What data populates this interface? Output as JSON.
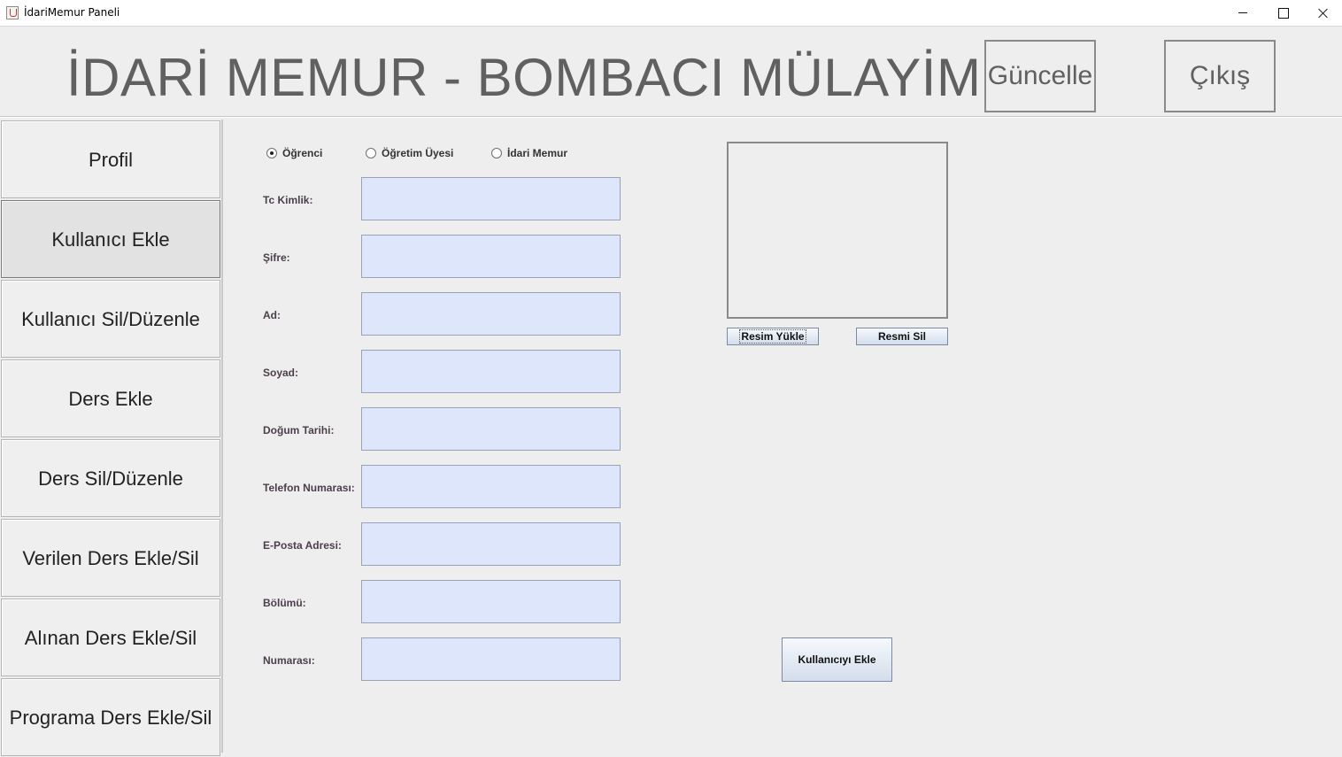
{
  "window": {
    "title": "İdariMemur Paneli"
  },
  "header": {
    "title": "İDARİ MEMUR - BOMBACI MÜLAYİM",
    "update_label": "Güncelle",
    "exit_label": "Çıkış"
  },
  "sidebar": {
    "items": [
      {
        "label": "Profil"
      },
      {
        "label": "Kullanıcı Ekle",
        "active": true
      },
      {
        "label": "Kullanıcı Sil/Düzenle"
      },
      {
        "label": "Ders Ekle"
      },
      {
        "label": "Ders Sil/Düzenle"
      },
      {
        "label": "Verilen Ders Ekle/Sil"
      },
      {
        "label": "Alınan Ders Ekle/Sil"
      },
      {
        "label": "Programa Ders Ekle/Sil"
      }
    ]
  },
  "user_type": {
    "options": [
      "Öğrenci",
      "Öğretim Üyesi",
      "İdari Memur"
    ],
    "selected": "Öğrenci"
  },
  "form": {
    "fields": [
      {
        "label": "Tc Kimlik:",
        "value": ""
      },
      {
        "label": "Şifre:",
        "value": ""
      },
      {
        "label": "Ad:",
        "value": ""
      },
      {
        "label": "Soyad:",
        "value": ""
      },
      {
        "label": "Doğum Tarihi:",
        "value": ""
      },
      {
        "label": "Telefon Numarası:",
        "value": ""
      },
      {
        "label": "E-Posta Adresi:",
        "value": ""
      },
      {
        "label": "Bölümü:",
        "value": ""
      },
      {
        "label": "Numarası:",
        "value": ""
      }
    ]
  },
  "photo": {
    "upload_label": "Resim Yükle",
    "remove_label": "Resmi Sil"
  },
  "actions": {
    "add_user_label": "Kullanıcıyı Ekle"
  },
  "colors": {
    "input_background": "#dee6fb",
    "panel_background": "#eeeeee",
    "title_text": "#606060"
  }
}
